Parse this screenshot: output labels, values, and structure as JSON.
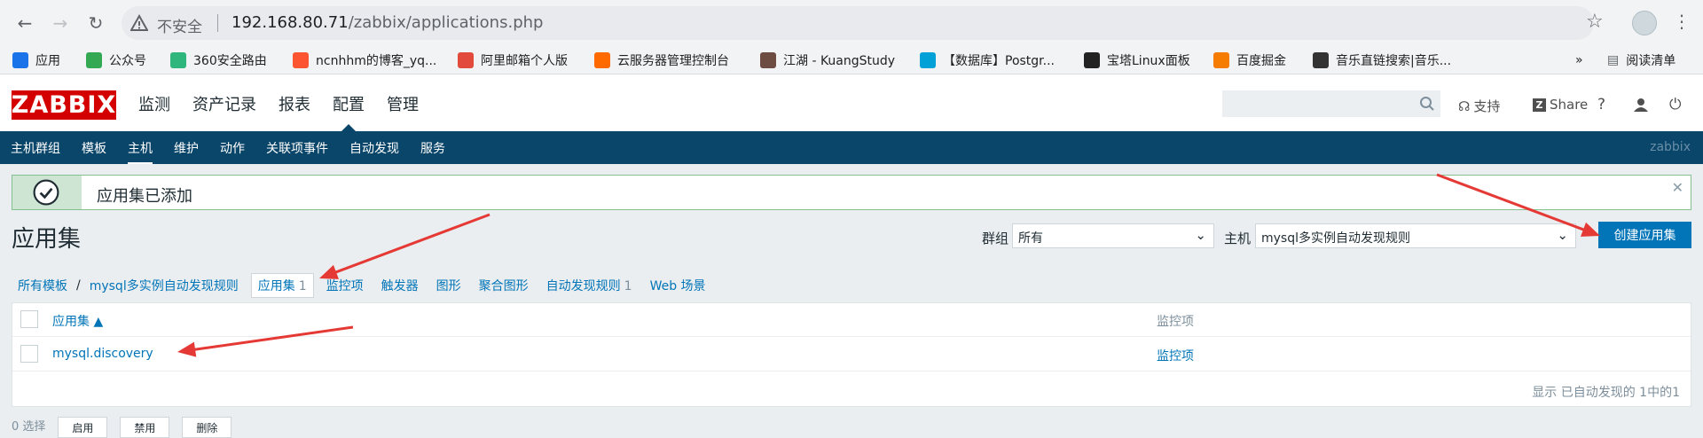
{
  "browser": {
    "insecure_label": "不安全",
    "url_host": "192.168.80.71",
    "url_path": "/zabbix/applications.php",
    "bookmarks": [
      {
        "label": "应用",
        "icon": "apps-grid-icon",
        "color": "#1a73e8"
      },
      {
        "label": "公众号",
        "icon": "wechat-icon",
        "color": "#34a853"
      },
      {
        "label": "360安全路由",
        "icon": "360-icon",
        "color": "#2eb67d"
      },
      {
        "label": "ncnhhm的博客_yq...",
        "icon": "csdn-icon",
        "color": "#fc5531"
      },
      {
        "label": "阿里邮箱个人版",
        "icon": "aliyun-mail-icon",
        "color": "#e24a3b"
      },
      {
        "label": "云服务器管理控制台",
        "icon": "aliyun-icon",
        "color": "#ff6a00"
      },
      {
        "label": "江湖 - KuangStudy",
        "icon": "kuangstudy-icon",
        "color": "#6d4c41"
      },
      {
        "label": "【数据库】Postgr...",
        "icon": "bilibili-icon",
        "color": "#00a1d6"
      },
      {
        "label": "宝塔Linux面板",
        "icon": "bt-icon",
        "color": "#222222"
      },
      {
        "label": "百度掘金",
        "icon": "juejin-icon",
        "color": "#f57c00"
      },
      {
        "label": "音乐直链搜索|音乐...",
        "icon": "music-icon",
        "color": "#333333"
      }
    ],
    "more_label": "»",
    "reading_list": "阅读清单"
  },
  "header": {
    "logo": "ZABBIX",
    "menu": [
      "监测",
      "资产记录",
      "报表",
      "配置",
      "管理"
    ],
    "active_menu": "配置",
    "support": "支持",
    "share": "Share",
    "help": "?"
  },
  "subnav": {
    "items": [
      "主机群组",
      "模板",
      "主机",
      "维护",
      "动作",
      "关联项事件",
      "自动发现",
      "服务"
    ],
    "active": "主机",
    "server_name": "zabbix"
  },
  "message": {
    "text": "应用集已添加"
  },
  "page": {
    "title": "应用集",
    "group_label": "群组",
    "group_value": "所有",
    "host_label": "主机",
    "host_value": "mysql多实例自动发现规则",
    "create_button": "创建应用集"
  },
  "crumbs": {
    "all_templates": "所有模板",
    "host": "mysql多实例自动发现规则",
    "tabs": [
      {
        "label": "应用集",
        "count": "1"
      },
      {
        "label": "监控项",
        "count": ""
      },
      {
        "label": "触发器",
        "count": ""
      },
      {
        "label": "图形",
        "count": ""
      },
      {
        "label": "聚合图形",
        "count": ""
      },
      {
        "label": "自动发现规则",
        "count": "1"
      },
      {
        "label": "Web 场景",
        "count": ""
      }
    ]
  },
  "table": {
    "col_app": "应用集 ▲",
    "col_items": "监控项",
    "rows": [
      {
        "app": "mysql.discovery",
        "items": "监控项"
      }
    ],
    "footer": "显示 已自动发现的 1中的1"
  },
  "bottom": {
    "label": "0 选择",
    "buttons": [
      "启用",
      "禁用",
      "删除"
    ]
  },
  "annotation_color": "#e53935"
}
